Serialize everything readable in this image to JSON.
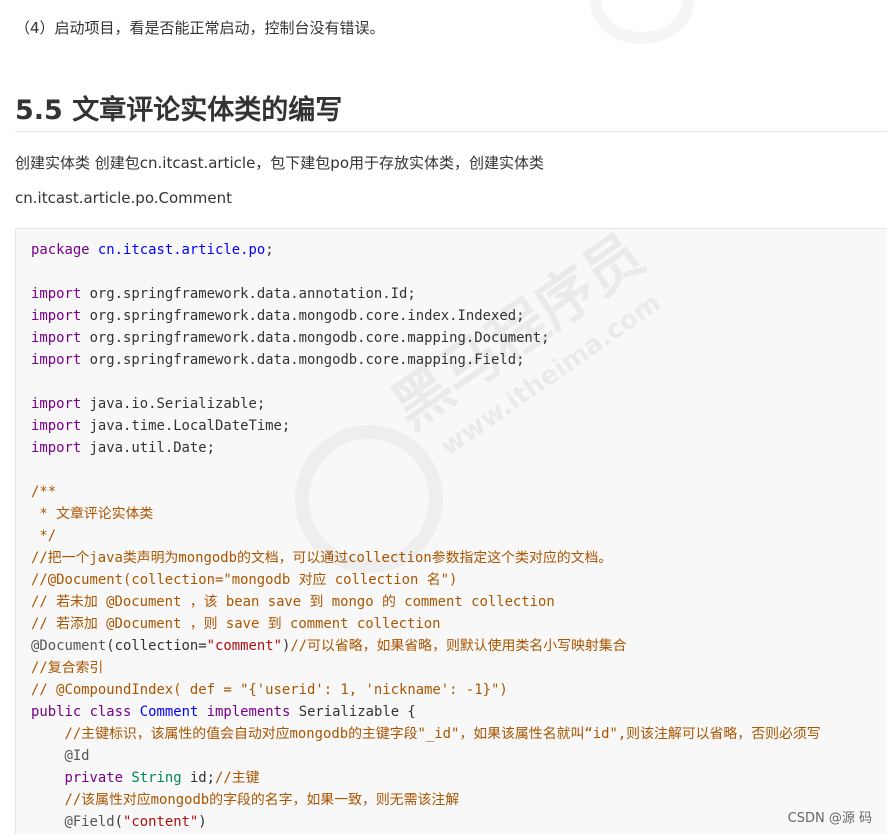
{
  "step_text": "（4）启动项目，看是否能正常启动，控制台没有错误。",
  "heading": "5.5 文章评论实体类的编写",
  "para1": "创建实体类 创建包cn.itcast.article，包下建包po用于存放实体类，创建实体类",
  "para2": "cn.itcast.article.po.Comment",
  "code": {
    "package_kw": "package",
    "package_name": "cn.itcast.article.po",
    "import_kw": "import",
    "imports": [
      "org.springframework.data.annotation.Id",
      "org.springframework.data.mongodb.core.index.Indexed",
      "org.springframework.data.mongodb.core.mapping.Document",
      "org.springframework.data.mongodb.core.mapping.Field",
      "java.io.Serializable",
      "java.time.LocalDateTime",
      "java.util.Date"
    ],
    "javadoc_open": "/**",
    "javadoc_line": " * 文章评论实体类",
    "javadoc_close": " */",
    "comment1": "//把一个java类声明为mongodb的文档，可以通过collection参数指定这个类对应的文档。",
    "comment2": "//@Document(collection=\"mongodb 对应 collection 名\")",
    "comment3": "// 若未加 @Document ，该 bean save 到 mongo 的 comment collection",
    "comment4": "// 若添加 @Document ，则 save 到 comment collection",
    "doc_annotation": "@Document",
    "doc_arg_name": "collection",
    "doc_arg_value": "\"comment\"",
    "doc_comment": "//可以省略，如果省略，则默认使用类名小写映射集合",
    "comment5": "//复合索引",
    "comment6": "// @CompoundIndex( def = \"{'userid': 1, 'nickname': -1}\")",
    "kw_public": "public",
    "kw_class": "class",
    "class_name": "Comment",
    "kw_implements": "implements",
    "interface_name": "Serializable",
    "field_comment1": "//主键标识，该属性的值会自动对应mongodb的主键字段\"_id\"，如果该属性名就叫“id\",则该注解可以省略，否则必须写",
    "id_annotation": "@Id",
    "kw_private": "private",
    "type_string": "String",
    "field_id": "id",
    "field_id_comment": "//主键",
    "field_comment2": "//该属性对应mongodb的字段的名字，如果一致，则无需该注解",
    "field_annotation": "@Field",
    "field_annotation_value": "\"content\""
  },
  "watermark": {
    "brand": "黑马程序员",
    "url": "www.itheima.com"
  },
  "csdn_watermark": "CSDN @源 码"
}
